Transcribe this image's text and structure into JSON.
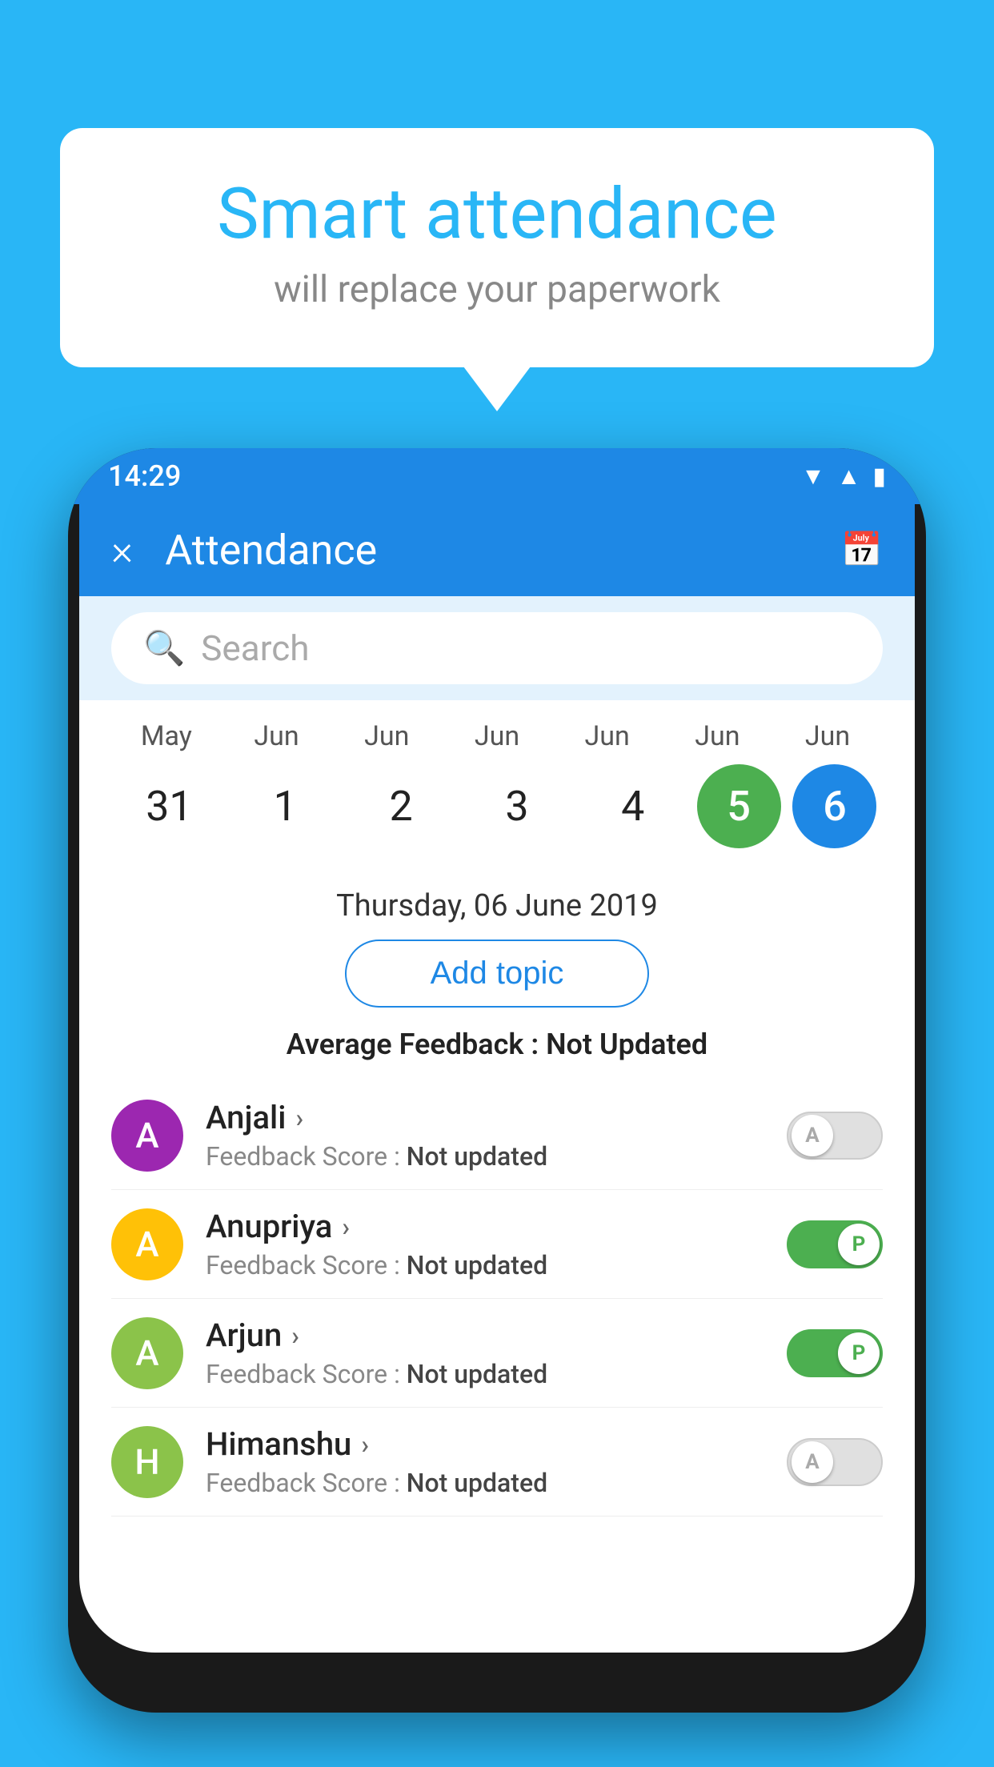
{
  "background": {
    "color": "#29B6F6"
  },
  "speech_bubble": {
    "title": "Smart attendance",
    "subtitle": "will replace your paperwork"
  },
  "phone": {
    "status_bar": {
      "time": "14:29",
      "icons": [
        "wifi",
        "signal",
        "battery"
      ]
    },
    "app_bar": {
      "title": "Attendance",
      "close_label": "×",
      "calendar_icon": "📅"
    },
    "search": {
      "placeholder": "Search"
    },
    "calendar": {
      "months": [
        "May",
        "Jun",
        "Jun",
        "Jun",
        "Jun",
        "Jun",
        "Jun"
      ],
      "dates": [
        "31",
        "1",
        "2",
        "3",
        "4",
        "5",
        "6"
      ],
      "today_index": 5,
      "selected_index": 6
    },
    "selected_date": "Thursday, 06 June 2019",
    "add_topic_label": "Add topic",
    "avg_feedback_label": "Average Feedback :",
    "avg_feedback_value": "Not Updated",
    "students": [
      {
        "name": "Anjali",
        "avatar_letter": "A",
        "avatar_color": "#9C27B0",
        "feedback_label": "Feedback Score :",
        "feedback_value": "Not updated",
        "attendance": "off",
        "toggle_letter": "A"
      },
      {
        "name": "Anupriya",
        "avatar_letter": "A",
        "avatar_color": "#FFC107",
        "feedback_label": "Feedback Score :",
        "feedback_value": "Not updated",
        "attendance": "on",
        "toggle_letter": "P"
      },
      {
        "name": "Arjun",
        "avatar_letter": "A",
        "avatar_color": "#8BC34A",
        "feedback_label": "Feedback Score :",
        "feedback_value": "Not updated",
        "attendance": "on",
        "toggle_letter": "P"
      },
      {
        "name": "Himanshu",
        "avatar_letter": "H",
        "avatar_color": "#8BC34A",
        "feedback_label": "Feedback Score :",
        "feedback_value": "Not updated",
        "attendance": "off",
        "toggle_letter": "A"
      }
    ]
  }
}
